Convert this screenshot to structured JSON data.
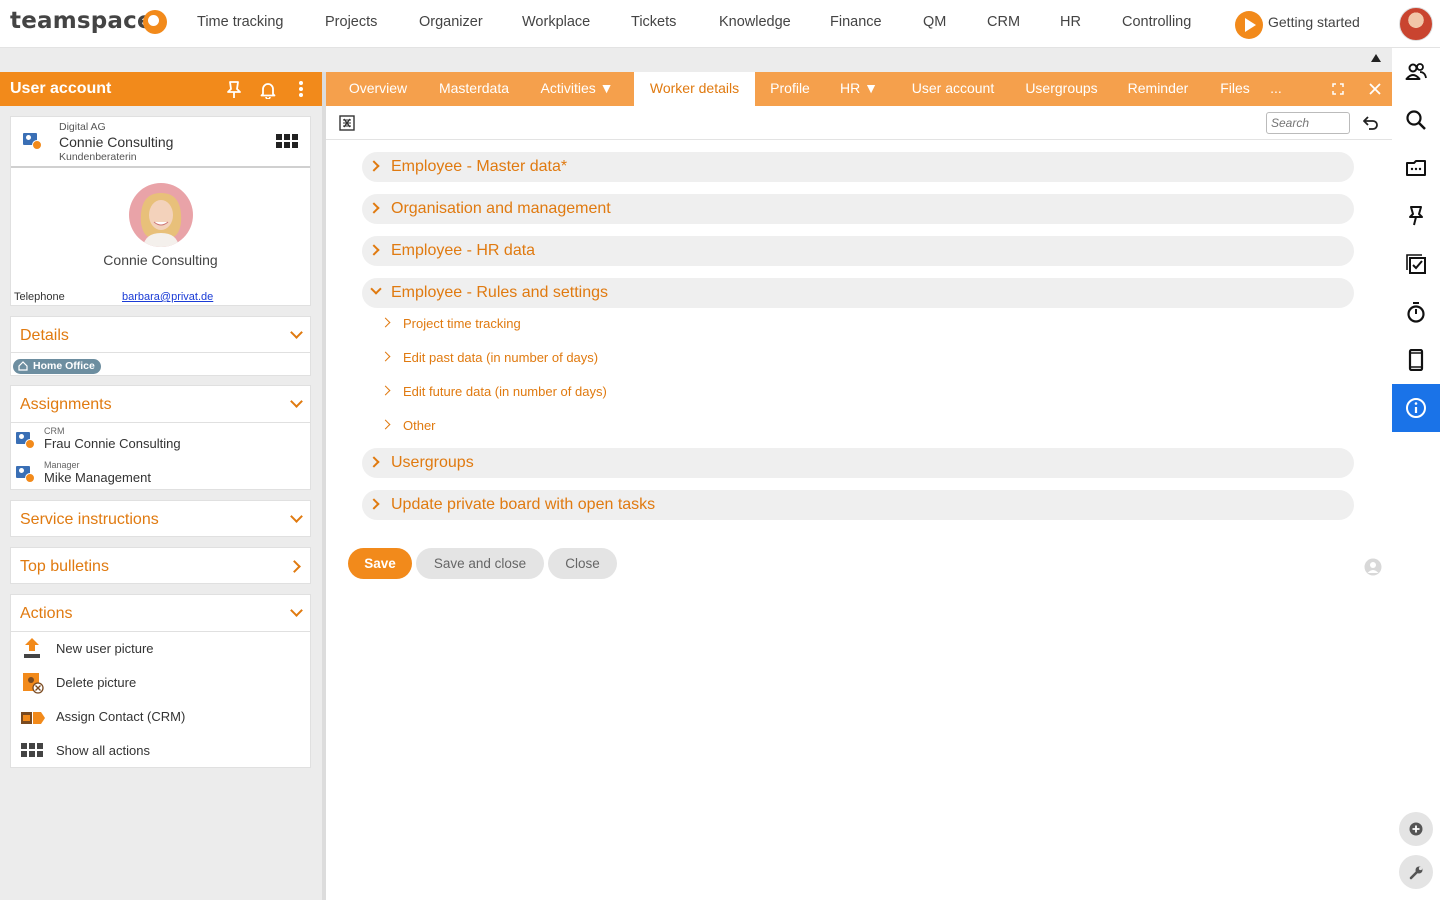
{
  "app": {
    "logo_text": "teamspace"
  },
  "topnav": {
    "items": [
      "Time tracking",
      "Projects",
      "Organizer",
      "Workplace",
      "Tickets",
      "Knowledge",
      "Finance",
      "QM",
      "CRM",
      "HR",
      "Controlling"
    ],
    "getting_started": "Getting started"
  },
  "left": {
    "header_title": "User account",
    "profile": {
      "company": "Digital AG",
      "name": "Connie Consulting",
      "role": "Kundenberaterin",
      "display_name": "Connie Consulting",
      "telephone_label": "Telephone",
      "email": "barbara@privat.de"
    },
    "details": {
      "title": "Details",
      "badge": "Home Office"
    },
    "assignments": {
      "title": "Assignments",
      "items": [
        {
          "label": "CRM",
          "value": "Frau Connie Consulting"
        },
        {
          "label": "Manager",
          "value": "Mike Management"
        }
      ]
    },
    "service_instructions": {
      "title": "Service instructions"
    },
    "top_bulletins": {
      "title": "Top bulletins"
    },
    "actions": {
      "title": "Actions",
      "items": [
        "New user picture",
        "Delete picture",
        "Assign Contact (CRM)",
        "Show all actions"
      ]
    }
  },
  "tabs": {
    "items": [
      "Overview",
      "Masterdata",
      "Activities ▼",
      "Worker details",
      "Profile",
      "HR ▼",
      "User account",
      "Usergroups",
      "Reminder",
      "Files",
      "..."
    ],
    "active": "Worker details"
  },
  "toolbar": {
    "search_placeholder": "Search"
  },
  "sections": {
    "items": [
      "Employee - Master data*",
      "Organisation and management",
      "Employee - HR data",
      "Employee - Rules and settings",
      "Usergroups",
      "Update private board with open tasks"
    ],
    "expanded": "Employee - Rules and settings",
    "subitems": [
      "Project time tracking",
      "Edit past data (in number of days)",
      "Edit future data (in number of days)",
      "Other"
    ]
  },
  "buttons": {
    "save": "Save",
    "save_close": "Save and close",
    "close": "Close"
  },
  "colors": {
    "accent": "#f28a1b",
    "tab_bar": "#f5a04c",
    "sidebar_active": "#1a73e8"
  }
}
